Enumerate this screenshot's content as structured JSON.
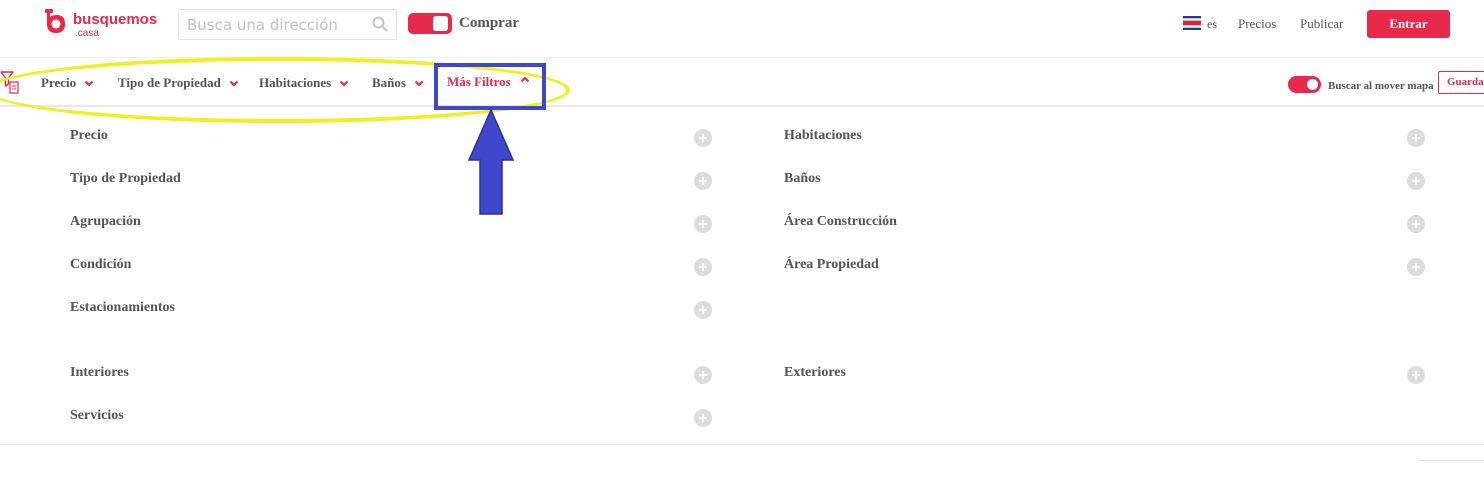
{
  "brand": {
    "name": "busquemos",
    "sub": ".casa",
    "color": "#e8294c"
  },
  "header": {
    "search_placeholder": "Busca una dirección",
    "mode_label": "Comprar",
    "lang": "es",
    "precios": "Precios",
    "publicar": "Publicar",
    "entrar": "Entrar"
  },
  "filterbar": {
    "items": [
      {
        "label": "Precio"
      },
      {
        "label": "Tipo de Propiedad"
      },
      {
        "label": "Habitaciones"
      },
      {
        "label": "Baños"
      },
      {
        "label": "Más Filtros",
        "active": true
      }
    ],
    "map_toggle_label": "Buscar al mover mapa",
    "map_toggle_on": true,
    "guardar": "Guardar"
  },
  "panel": {
    "left": [
      "Precio",
      "Tipo de Propiedad",
      "Agrupación",
      "Condición",
      "Estacionamientos"
    ],
    "right": [
      "Habitaciones",
      "Baños",
      "Área Construcción",
      "Área Propiedad"
    ],
    "left2": [
      "Interiores",
      "Servicios"
    ],
    "right2": [
      "Exteriores"
    ]
  },
  "annotations": {
    "highlight_color": "#f2ee1f",
    "box_color": "#3f47cc"
  }
}
